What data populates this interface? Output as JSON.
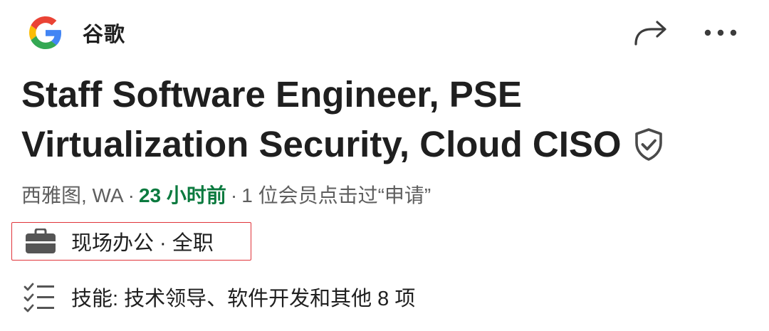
{
  "header": {
    "company_name": "谷歌",
    "logo_icon": "google-g-logo",
    "share_icon": "share-arrow-icon",
    "more_icon": "more-dots-icon"
  },
  "job": {
    "title": "Staff Software Engineer, PSE Virtualization Security, Cloud CISO",
    "verified_icon": "shield-check-icon",
    "location": "西雅图, WA",
    "separator": "·",
    "posted": "23 小时前",
    "applicants": "1 位会员点击过“申请”",
    "workplace": {
      "icon": "briefcase-icon",
      "label": "现场办公 · 全职",
      "highlight_color": "#e0343a"
    },
    "skills": {
      "icon": "checklist-icon",
      "label": "技能: 技术领导、软件开发和其他 8 项"
    }
  },
  "colors": {
    "posted_green": "#0b7a3f",
    "text_primary": "#1f1f1f",
    "text_secondary": "#5e5e5e"
  }
}
